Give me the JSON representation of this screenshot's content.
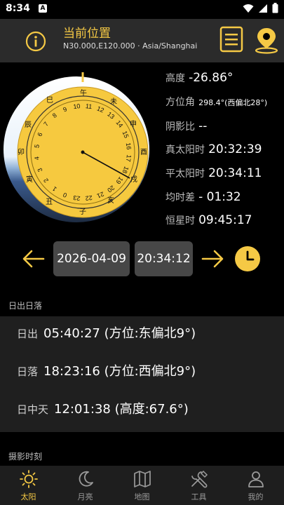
{
  "status_bar": {
    "time": "8:34",
    "notification_letter": "A"
  },
  "header": {
    "title": "当前位置",
    "subtitle": "N30.000,E120.000 · Asia/Shanghai"
  },
  "dial": {
    "branches_top": [
      "午",
      "未",
      "巳"
    ],
    "branches_side": [
      "申",
      "辰",
      "酉",
      "卯",
      "戌",
      "寅"
    ],
    "branches_bottom": [
      "亥",
      "丑",
      "子"
    ],
    "hours": [
      "11",
      "12",
      "13",
      "14",
      "15",
      "16",
      "17",
      "18",
      "19",
      "20",
      "21",
      "22",
      "23",
      "0",
      "1",
      "2",
      "3",
      "4",
      "5",
      "6",
      "7",
      "8",
      "9",
      "10"
    ]
  },
  "params": {
    "altitude_label": "高度",
    "altitude_value": "-26.86°",
    "azimuth_label": "方位角",
    "azimuth_value": "298.4°(西偏北28°)",
    "shadow_label": "阴影比",
    "shadow_value": "--",
    "true_solar_label": "真太阳时",
    "true_solar_value": "20:32:39",
    "mean_solar_label": "平太阳时",
    "mean_solar_value": "20:34:11",
    "eq_time_label": "均时差",
    "eq_time_value": "- 01:32",
    "sidereal_label": "恒星时",
    "sidereal_value": "09:45:17"
  },
  "datetime": {
    "date": "2026-04-09",
    "time": "20:34:12"
  },
  "sunrise_section": {
    "title": "日出日落",
    "sunrise_label": "日出",
    "sunrise_value": "05:40:27 (方位:东偏北9°)",
    "sunset_label": "日落",
    "sunset_value": "18:23:16 (方位:西偏北9°)",
    "noon_label": "日中天",
    "noon_value": "12:01:38 (高度:67.6°)"
  },
  "photo_section": {
    "title": "摄影时刻"
  },
  "nav": {
    "items": [
      {
        "label": "太阳",
        "icon": "sun-icon"
      },
      {
        "label": "月亮",
        "icon": "moon-icon"
      },
      {
        "label": "地图",
        "icon": "map-icon"
      },
      {
        "label": "工具",
        "icon": "tools-icon"
      },
      {
        "label": "我的",
        "icon": "person-icon"
      }
    ]
  },
  "colors": {
    "accent": "#F5C945",
    "background": "#000000",
    "header": "#2B2B2B",
    "card": "#1F1F1F"
  }
}
